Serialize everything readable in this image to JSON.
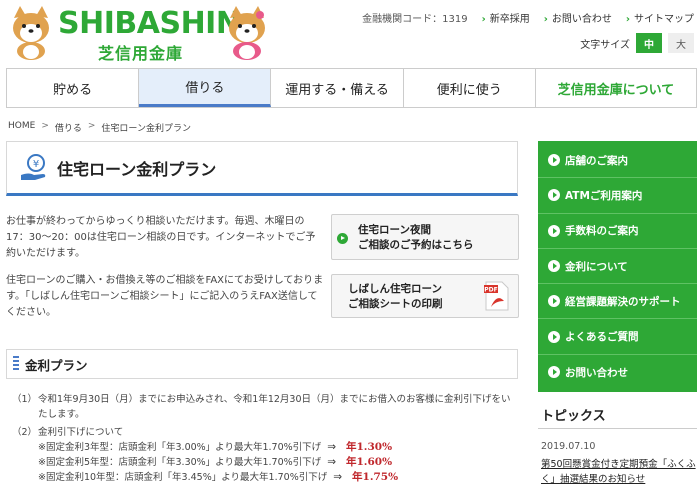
{
  "header": {
    "brand_en": "SHIBASHIN",
    "brand_jp": "芝信用金庫",
    "institution_code": "金融機関コード：1319",
    "util_links": [
      "新卒採用",
      "お問い合わせ",
      "サイトマップ"
    ],
    "font_size_label": "文字サイズ",
    "font_size_options": [
      "中",
      "大"
    ]
  },
  "nav": {
    "items": [
      "貯める",
      "借りる",
      "運用する・備える",
      "便利に使う",
      "芝信用金庫について"
    ]
  },
  "breadcrumb": [
    "HOME",
    "借りる",
    "住宅ローン金利プラン"
  ],
  "main": {
    "title": "住宅ローン金利プラン",
    "text1": "お仕事が終わってからゆっくり相談いただけます。毎週、木曜日の17：30～20：00は住宅ローン相談の日です。インターネットでご予約いただけます。",
    "text2": "住宅ローンのご購入・お借換え等のご相談をFAXにてお受けしております。「しばしん住宅ローンご相談シート」にご記入のうえFAX送信してください。",
    "btn1_line1": "住宅ローン夜間",
    "btn1_line2": "ご相談のご予約はこちら",
    "btn2_line1": "しばしん住宅ローン",
    "btn2_line2": "ご相談シートの印刷",
    "pdf_label": "PDF",
    "section_title": "金利プラン",
    "items": [
      {
        "num": "（1）",
        "text": "令和1年9月30日（月）までにお申込みされ、令和1年12月30日（月）までにお借入のお客様に金利引下げをいたします。"
      },
      {
        "num": "（2）",
        "text": "金利引下げについて"
      }
    ],
    "rates": [
      {
        "text": "※固定金利3年型：店頭金利「年3.00%」より最大年1.70%引下げ",
        "rate": "年1.30%"
      },
      {
        "text": "※固定金利5年型：店頭金利「年3.30%」より最大年1.70%引下げ",
        "rate": "年1.60%"
      },
      {
        "text": "※固定金利10年型：店頭金利「年3.45%」より最大年1.70%引下げ",
        "rate": "年1.75%"
      }
    ]
  },
  "sidebar": {
    "items": [
      "店舗のご案内",
      "ATMご利用案内",
      "手数料のご案内",
      "金利について",
      "経営課題解決のサポート",
      "よくあるご質問",
      "お問い合わせ"
    ]
  },
  "topics": {
    "title": "トピックス",
    "date": "2019.07.10",
    "text": "第50回懸賞金付き定期預金「ふくふく」抽選結果のお知らせ"
  },
  "colors": {
    "brand_green": "#2ea836",
    "accent_blue": "#3a78c3",
    "rate_red": "#c0282d"
  }
}
